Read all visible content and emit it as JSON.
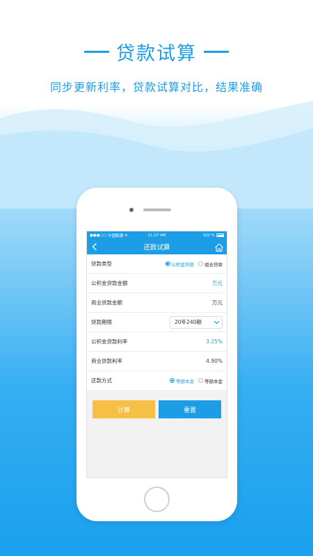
{
  "header": {
    "title": "贷款试算",
    "subtitle": "同步更新利率，贷款试算对比，结果准确"
  },
  "colors": {
    "primary": "#1c9de6",
    "calc_button": "#f8bf46",
    "reset_button": "#1c9de6"
  },
  "status_bar": {
    "carrier": "中国联通",
    "time": "11:27 AM",
    "battery": "100 %"
  },
  "navbar": {
    "title": "还款试算",
    "back_icon": "chevron-left-icon",
    "home_icon": "home-icon"
  },
  "form": {
    "loan_type": {
      "label": "贷款类型",
      "options": [
        "公积金贷款",
        "组合贷款"
      ],
      "selected": "公积金贷款"
    },
    "fund_amount": {
      "label": "公积金贷款金额",
      "unit": "万元"
    },
    "commercial_amount": {
      "label": "商业贷款金额",
      "unit": "万元"
    },
    "loan_term": {
      "label": "贷款期限",
      "value": "20年240期"
    },
    "fund_rate": {
      "label": "公积金贷款利率",
      "value": "3.25%"
    },
    "commercial_rate": {
      "label": "商业贷款利率",
      "value": "4.90%"
    },
    "repayment_method": {
      "label": "还款方式",
      "options": [
        "等额本息",
        "等额本金"
      ],
      "selected": "等额本息"
    }
  },
  "buttons": {
    "calculate": "计算",
    "reset": "重置"
  }
}
